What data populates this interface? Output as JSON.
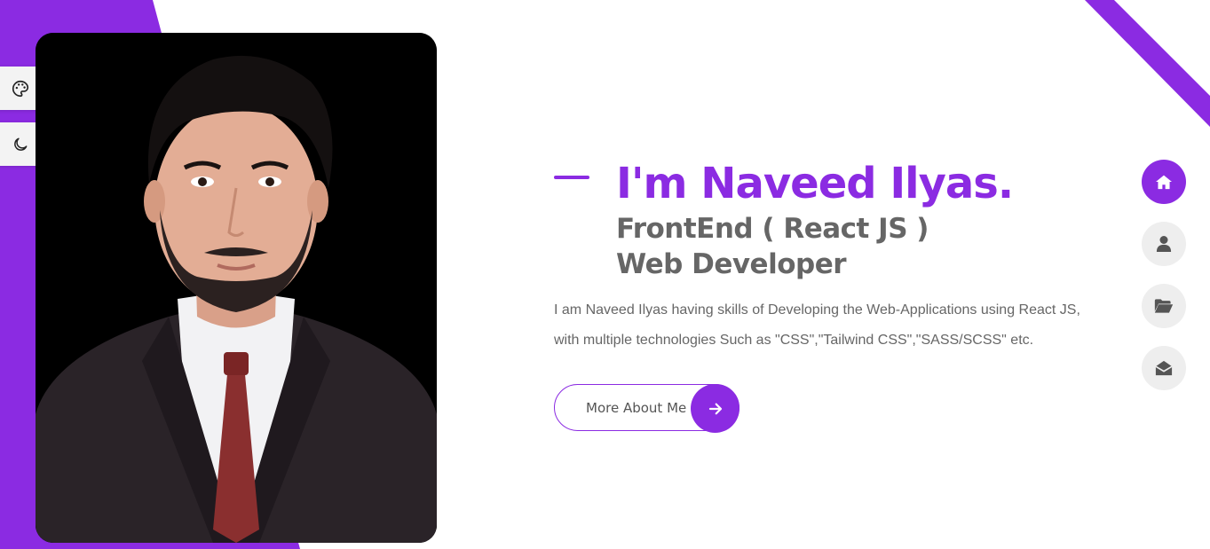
{
  "colors": {
    "accent": "#8b2be2",
    "text_gray": "#666666",
    "nav_bg": "#eeeeee",
    "white": "#ffffff"
  },
  "hero": {
    "title": "I'm Naveed Ilyas.",
    "subtitle_line1": "FrontEnd ( React JS )",
    "subtitle_line2": "Web Developer",
    "description": "I am Naveed Ilyas having skills of Developing the Web-Applications using React JS, with multiple technologies Such as \"CSS\",\"Tailwind CSS\",\"SASS/SCSS\" etc.",
    "cta_label": "More About Me",
    "cta_icon": "arrow-right-icon"
  },
  "side_tools": [
    {
      "name": "color-palette",
      "icon": "palette-icon"
    },
    {
      "name": "dark-mode-toggle",
      "icon": "moon-icon"
    }
  ],
  "nav": [
    {
      "name": "home",
      "icon": "home-icon",
      "active": true
    },
    {
      "name": "about",
      "icon": "user-icon",
      "active": false
    },
    {
      "name": "portfolio",
      "icon": "folder-open-icon",
      "active": false
    },
    {
      "name": "contact",
      "icon": "envelope-open-icon",
      "active": false
    }
  ],
  "photo": {
    "subject": "portrait"
  }
}
